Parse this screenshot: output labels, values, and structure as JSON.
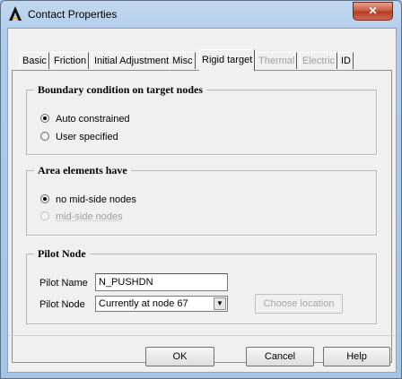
{
  "window": {
    "title": "Contact Properties",
    "close_label": "✕"
  },
  "tabs": [
    {
      "label": "Basic",
      "state": "normal"
    },
    {
      "label": "Friction",
      "state": "normal"
    },
    {
      "label": "Initial Adjustment",
      "state": "normal"
    },
    {
      "label": "Misc",
      "state": "normal"
    },
    {
      "label": "Rigid target",
      "state": "active"
    },
    {
      "label": "Thermal",
      "state": "disabled"
    },
    {
      "label": "Electric",
      "state": "disabled"
    },
    {
      "label": "ID",
      "state": "normal"
    }
  ],
  "boundary_group": {
    "title": "Boundary condition on target nodes",
    "options": [
      {
        "label": "Auto constrained",
        "checked": true
      },
      {
        "label": "User specified",
        "checked": false
      }
    ]
  },
  "area_group": {
    "title": "Area elements have",
    "options": [
      {
        "label": "no mid-side nodes",
        "checked": true
      },
      {
        "label": "mid-side nodes",
        "checked": false,
        "disabled": true
      }
    ]
  },
  "pilot_group": {
    "title": "Pilot Node",
    "name_label": "Pilot Name",
    "name_value": "N_PUSHDN",
    "node_label": "Pilot Node",
    "node_selected": "Currently at node 67",
    "choose_button": "Choose location"
  },
  "buttons": {
    "ok": "OK",
    "cancel": "Cancel",
    "help": "Help"
  },
  "colors": {
    "titlebar": "#aecbeb",
    "close_button": "#c9563f",
    "dialog_bg": "#f0f0f0"
  }
}
